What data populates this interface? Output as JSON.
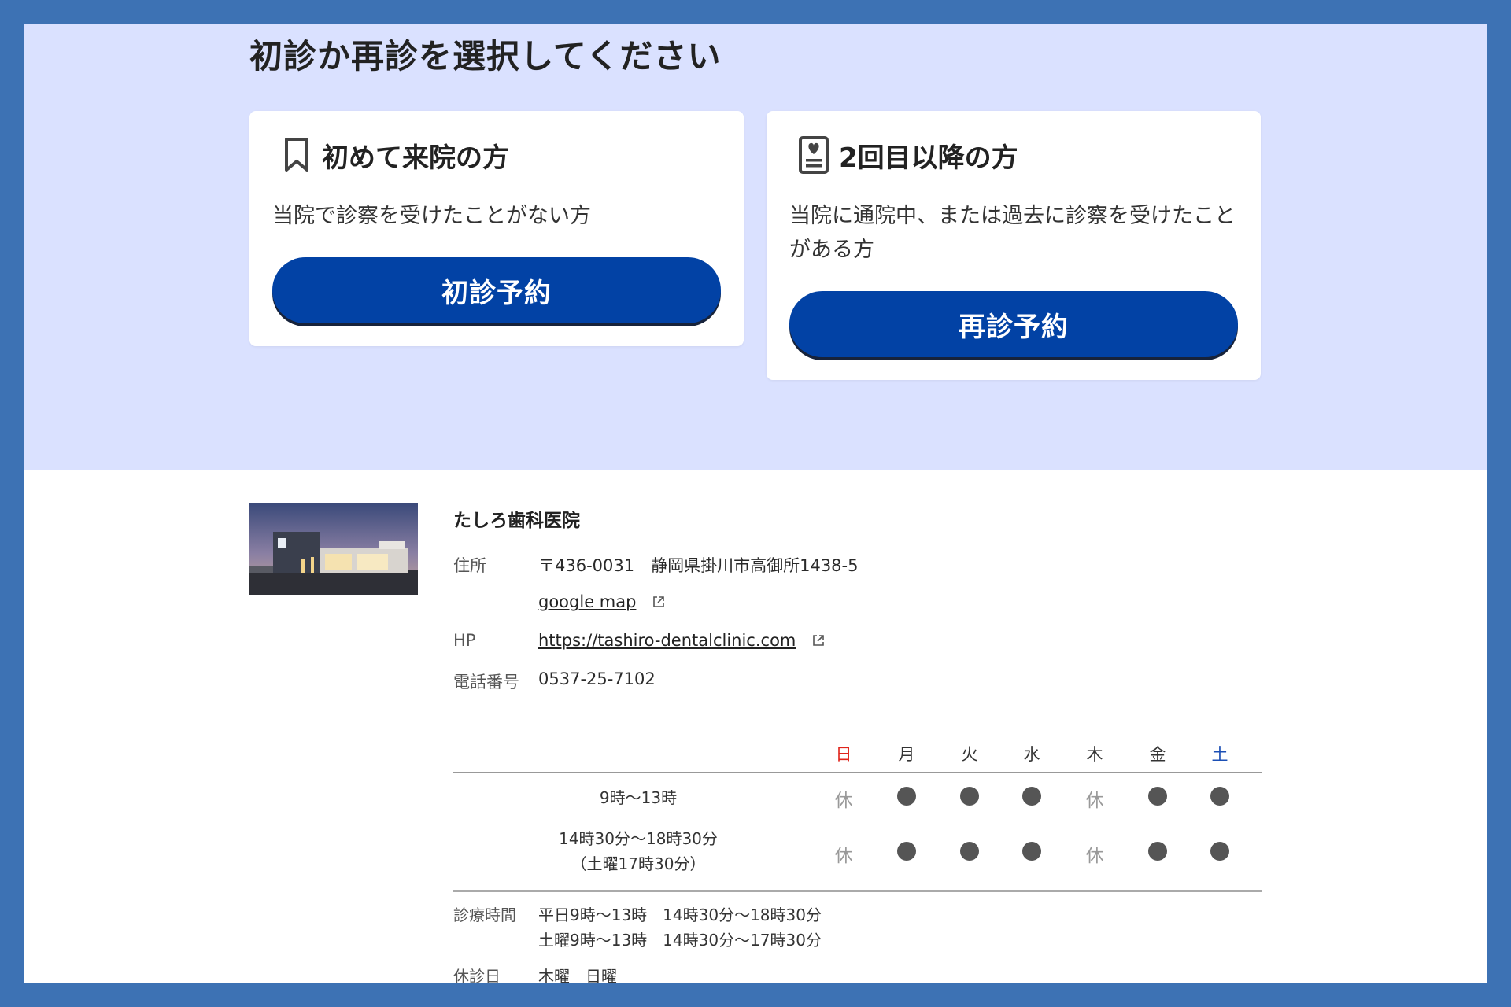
{
  "hero": {
    "title": "初診か再診を選択してください"
  },
  "cards": [
    {
      "icon": "bookmark-icon",
      "title": "初めて来院の方",
      "description": "当院で診察を受けたことがない方",
      "button_label": "初診予約"
    },
    {
      "icon": "medical-record-icon",
      "title": "2回目以降の方",
      "description": "当院に通院中、または過去に診察を受けたことがある方",
      "button_label": "再診予約"
    }
  ],
  "clinic": {
    "name": "たしろ歯科医院",
    "address_label": "住所",
    "address": "〒436-0031　静岡県掛川市高御所1438-5",
    "map_link": "google map",
    "hp_label": "HP",
    "hp_link": "https://tashiro-dentalclinic.com",
    "phone_label": "電話番号",
    "phone": "0537-25-7102"
  },
  "schedule": {
    "days": [
      "日",
      "月",
      "火",
      "水",
      "木",
      "金",
      "土"
    ],
    "day_colors": {
      "sunday": "#e0241b",
      "saturday": "#1b4fb5"
    },
    "rows": [
      {
        "time_line1": "9時～13時",
        "time_line2": "",
        "cells": [
          "休",
          "●",
          "●",
          "●",
          "休",
          "●",
          "●"
        ]
      },
      {
        "time_line1": "14時30分～18時30分",
        "time_line2": "（土曜17時30分）",
        "cells": [
          "休",
          "●",
          "●",
          "●",
          "休",
          "●",
          "●"
        ]
      }
    ],
    "hours_label": "診療時間",
    "hours_line1": "平日9時～13時　14時30分～18時30分",
    "hours_line2": "土曜9時～13時　14時30分～17時30分",
    "closed_label": "休診日",
    "closed_value": "木曜　日曜"
  },
  "colors": {
    "hero_bg": "#dae1ff",
    "button": "#0242a5",
    "frame": "#3d72b4"
  }
}
